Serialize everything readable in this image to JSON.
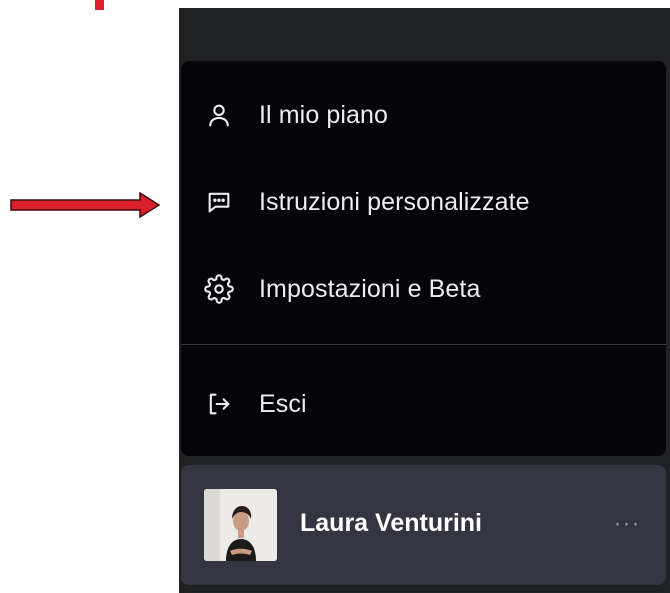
{
  "menu": {
    "items": [
      {
        "label": "Il mio piano",
        "icon": "user-icon"
      },
      {
        "label": "Istruzioni personalizzate",
        "icon": "chat-bubble-icon"
      },
      {
        "label": "Impostazioni e Beta",
        "icon": "gear-icon"
      },
      {
        "label": "Esci",
        "icon": "logout-icon"
      }
    ]
  },
  "profile": {
    "name": "Laura Venturini",
    "more_label": "···"
  },
  "colors": {
    "sidebar_bg": "#202123",
    "menu_bg": "#050509",
    "profile_bg": "#343541",
    "text": "#ececf1",
    "annotation_arrow": "#d9202b"
  }
}
